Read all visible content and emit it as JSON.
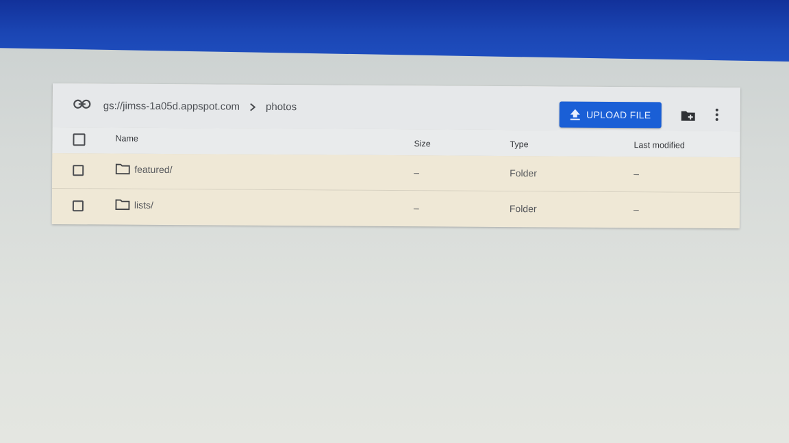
{
  "toolbar": {
    "bucket_path": "gs://jimss-1a05d.appspot.com",
    "current_folder": "photos",
    "upload_label": "UPLOAD FILE",
    "icons": {
      "link": "link-icon",
      "separator": "chevron-right-icon",
      "upload": "upload-icon",
      "new_folder": "create-new-folder-icon",
      "more": "more-vert-icon"
    }
  },
  "table": {
    "columns": [
      "Name",
      "Size",
      "Type",
      "Last modified"
    ],
    "rows": [
      {
        "name": "featured/",
        "size": "–",
        "type": "Folder",
        "modified": "–"
      },
      {
        "name": "lists/",
        "size": "–",
        "type": "Folder",
        "modified": "–"
      }
    ]
  },
  "colors": {
    "accent": "#1a5fd6",
    "top_band": "#1b46b4",
    "row_background": "#efe8d6"
  }
}
